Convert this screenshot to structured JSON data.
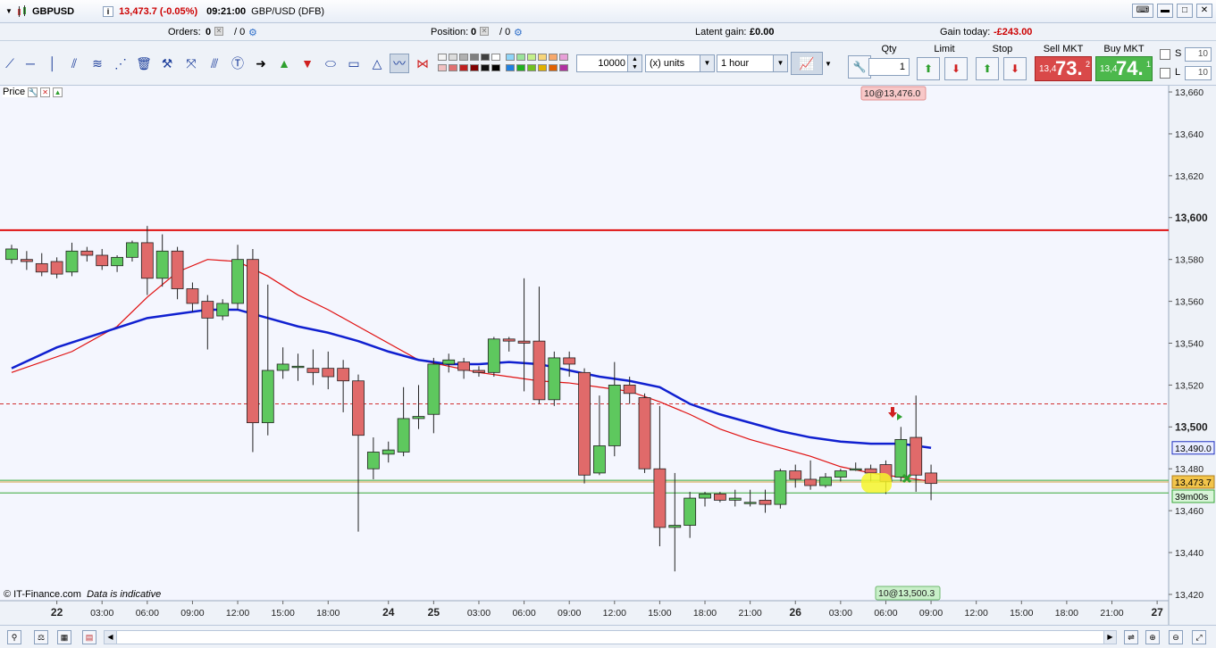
{
  "window": {
    "symbol": "GBPUSD",
    "price_change": "13,473.7 (-0.05%)",
    "time": "09:21:00",
    "instrument_name": "GBP/USD (DFB)",
    "info_icon": "i"
  },
  "infobar": {
    "orders_label": "Orders:",
    "orders_value": "0",
    "orders_sep": "/ 0",
    "position_label": "Position:",
    "position_value": "0",
    "position_sep": "/ 0",
    "latent_label": "Latent gain:",
    "latent_value": "£0.00",
    "gain_today_label": "Gain today:",
    "gain_today_value": "-£243.00"
  },
  "toolbar": {
    "quantity": "10000",
    "units": "(x) units",
    "timeframe": "1 hour"
  },
  "deal": {
    "qty_label": "Qty",
    "qty_value": "1",
    "limit_label": "Limit",
    "stop_label": "Stop",
    "sell_label": "Sell MKT",
    "buy_label": "Buy MKT",
    "sell_small": "13,4",
    "sell_big": "73.",
    "sell_sup": "2",
    "buy_small": "13,4",
    "buy_big": "74.",
    "buy_sup": "1",
    "s_label": "S",
    "l_label": "L",
    "s_value": "10",
    "l_value": "10"
  },
  "chart": {
    "panel_label": "Price",
    "copyright": "© IT-Finance.com",
    "disclaimer": "Data is indicative",
    "tag_top": "10@13,476.0",
    "tag_bottom": "10@13,500.3",
    "tag_ma": "13,490.0",
    "tag_price": "13,473.7",
    "tag_timer": "39m00s",
    "colors": {
      "up": "#5ec85e",
      "down": "#e06a6a",
      "ma_fast": "#e01010",
      "ma_slow": "#1020d0",
      "resistance": "#e01010",
      "bg": "#f4f6fe"
    }
  },
  "chart_data": {
    "type": "candlestick",
    "y_ticks": [
      "13,660",
      "13,640",
      "13,620",
      "13,600",
      "13,580",
      "13,560",
      "13,540",
      "13,520",
      "13,500",
      "13,480",
      "13,460",
      "13,440",
      "13,420"
    ],
    "y_tick_values": [
      13660,
      13640,
      13620,
      13600,
      13580,
      13560,
      13540,
      13520,
      13500,
      13480,
      13460,
      13440,
      13420
    ],
    "bold_ticks": [
      "13,600",
      "13,500"
    ],
    "ylim": [
      13417,
      13663
    ],
    "x_labels": [
      "22",
      "03:00",
      "06:00",
      "09:00",
      "12:00",
      "15:00",
      "18:00",
      "24",
      "25",
      "03:00",
      "06:00",
      "09:00",
      "12:00",
      "15:00",
      "18:00",
      "21:00",
      "26",
      "03:00",
      "06:00",
      "09:00",
      "12:00",
      "15:00",
      "18:00",
      "21:00",
      "27"
    ],
    "x_label_slots": [
      3,
      6,
      9,
      12,
      15,
      18,
      21,
      25,
      28,
      31,
      34,
      37,
      40,
      43,
      46,
      49,
      52,
      55,
      58,
      61,
      64,
      67,
      70,
      73,
      76
    ],
    "bold_x": [
      "22",
      "24",
      "25",
      "26",
      "27"
    ],
    "candles": [
      [
        13580,
        13585,
        13578,
        13587
      ],
      [
        13580,
        13579,
        13575,
        13584
      ],
      [
        13578,
        13574,
        13572,
        13583
      ],
      [
        13579,
        13573,
        13571,
        13581
      ],
      [
        13574,
        13584,
        13572,
        13588
      ],
      [
        13584,
        13582,
        13579,
        13586
      ],
      [
        13582,
        13577,
        13575,
        13585
      ],
      [
        13577,
        13581,
        13574,
        13582
      ],
      [
        13581,
        13588,
        13579,
        13589
      ],
      [
        13588,
        13571,
        13563,
        13596
      ],
      [
        13571,
        13584,
        13567,
        13592
      ],
      [
        13584,
        13566,
        13561,
        13586
      ],
      [
        13566,
        13559,
        13555,
        13569
      ],
      [
        13560,
        13552,
        13537,
        13563
      ],
      [
        13553,
        13559,
        13551,
        13561
      ],
      [
        13559,
        13580,
        13556,
        13587
      ],
      [
        13580,
        13502,
        13488,
        13585
      ],
      [
        13502,
        13527,
        13496,
        13568
      ],
      [
        13527,
        13530,
        13523,
        13538
      ],
      [
        13529,
        13529,
        13522,
        13535
      ],
      [
        13528,
        13526,
        13520,
        13537
      ],
      [
        13528,
        13524,
        13518,
        13536
      ],
      [
        13528,
        13522,
        13507,
        13532
      ],
      [
        13522,
        13496,
        13450,
        13525
      ],
      [
        13480,
        13488,
        13475,
        13495
      ],
      [
        13487,
        13489,
        13483,
        13493
      ],
      [
        13488,
        13504,
        13486,
        13519
      ],
      [
        13504,
        13505,
        13499,
        13520
      ],
      [
        13506,
        13530,
        13497,
        13533
      ],
      [
        13530,
        13532,
        13526,
        13535
      ],
      [
        13531,
        13527,
        13523,
        13533
      ],
      [
        13527,
        13526,
        13524,
        13529
      ],
      [
        13526,
        13542,
        13524,
        13543
      ],
      [
        13542,
        13541,
        13536,
        13543
      ],
      [
        13541,
        13540,
        13517,
        13571
      ],
      [
        13541,
        13513,
        13511,
        13567
      ],
      [
        13513,
        13533,
        13510,
        13536
      ],
      [
        13533,
        13530,
        13524,
        13536
      ],
      [
        13526,
        13477,
        13473,
        13528
      ],
      [
        13478,
        13491,
        13477,
        13515
      ],
      [
        13491,
        13520,
        13486,
        13531
      ],
      [
        13520,
        13516,
        13511,
        13524
      ],
      [
        13514,
        13480,
        13478,
        13516
      ],
      [
        13480,
        13452,
        13443,
        13510
      ],
      [
        13452,
        13453,
        13431,
        13478
      ],
      [
        13453,
        13466,
        13447,
        13469
      ],
      [
        13466,
        13468,
        13462,
        13469
      ],
      [
        13468,
        13465,
        13464,
        13469
      ],
      [
        13465,
        13466,
        13462,
        13470
      ],
      [
        13464,
        13464,
        13462,
        13470
      ],
      [
        13465,
        13463,
        13459,
        13470
      ],
      [
        13463,
        13479,
        13461,
        13480
      ],
      [
        13479,
        13475,
        13471,
        13482
      ],
      [
        13475,
        13472,
        13470,
        13484
      ],
      [
        13472,
        13476,
        13471,
        13478
      ],
      [
        13476,
        13479,
        13474,
        13480
      ],
      [
        13480,
        13480,
        13479,
        13483
      ],
      [
        13480,
        13478,
        13474,
        13482
      ],
      [
        13482,
        13474,
        13468,
        13484
      ],
      [
        13476,
        13494,
        13474,
        13500
      ],
      [
        13495,
        13477,
        13469,
        13515
      ],
      [
        13478,
        13473,
        13465,
        13482
      ]
    ],
    "ma_fast": [
      [
        0,
        13526
      ],
      [
        4,
        13536
      ],
      [
        7,
        13548
      ],
      [
        9,
        13562
      ],
      [
        11,
        13574
      ],
      [
        13,
        13580
      ],
      [
        15,
        13579
      ],
      [
        17,
        13572
      ],
      [
        19,
        13563
      ],
      [
        21,
        13556
      ],
      [
        23,
        13548
      ],
      [
        25,
        13540
      ],
      [
        27,
        13532
      ],
      [
        29,
        13529
      ],
      [
        31,
        13526
      ],
      [
        33,
        13524
      ],
      [
        35,
        13522
      ],
      [
        37,
        13521
      ],
      [
        39,
        13519
      ],
      [
        41,
        13517
      ],
      [
        43,
        13512
      ],
      [
        45,
        13506
      ],
      [
        47,
        13499
      ],
      [
        49,
        13494
      ],
      [
        51,
        13490
      ],
      [
        53,
        13486
      ],
      [
        55,
        13481
      ],
      [
        57,
        13478
      ],
      [
        59,
        13476
      ],
      [
        61,
        13474
      ]
    ],
    "ma_slow": [
      [
        0,
        13528
      ],
      [
        3,
        13538
      ],
      [
        6,
        13545
      ],
      [
        9,
        13552
      ],
      [
        11,
        13554
      ],
      [
        13,
        13556
      ],
      [
        15,
        13556
      ],
      [
        17,
        13552
      ],
      [
        19,
        13548
      ],
      [
        21,
        13545
      ],
      [
        23,
        13541
      ],
      [
        25,
        13536
      ],
      [
        27,
        13532
      ],
      [
        29,
        13530
      ],
      [
        31,
        13530
      ],
      [
        33,
        13531
      ],
      [
        35,
        13530
      ],
      [
        37,
        13527
      ],
      [
        39,
        13524
      ],
      [
        41,
        13522
      ],
      [
        43,
        13519
      ],
      [
        45,
        13511
      ],
      [
        47,
        13506
      ],
      [
        49,
        13502
      ],
      [
        51,
        13498
      ],
      [
        53,
        13495
      ],
      [
        55,
        13493
      ],
      [
        57,
        13492
      ],
      [
        59,
        13492
      ],
      [
        61,
        13490
      ]
    ],
    "resistance": 13594,
    "dashed_level": 13511,
    "price_level": 13473.7,
    "green_lines": [
      13474.5,
      13468.5
    ]
  }
}
